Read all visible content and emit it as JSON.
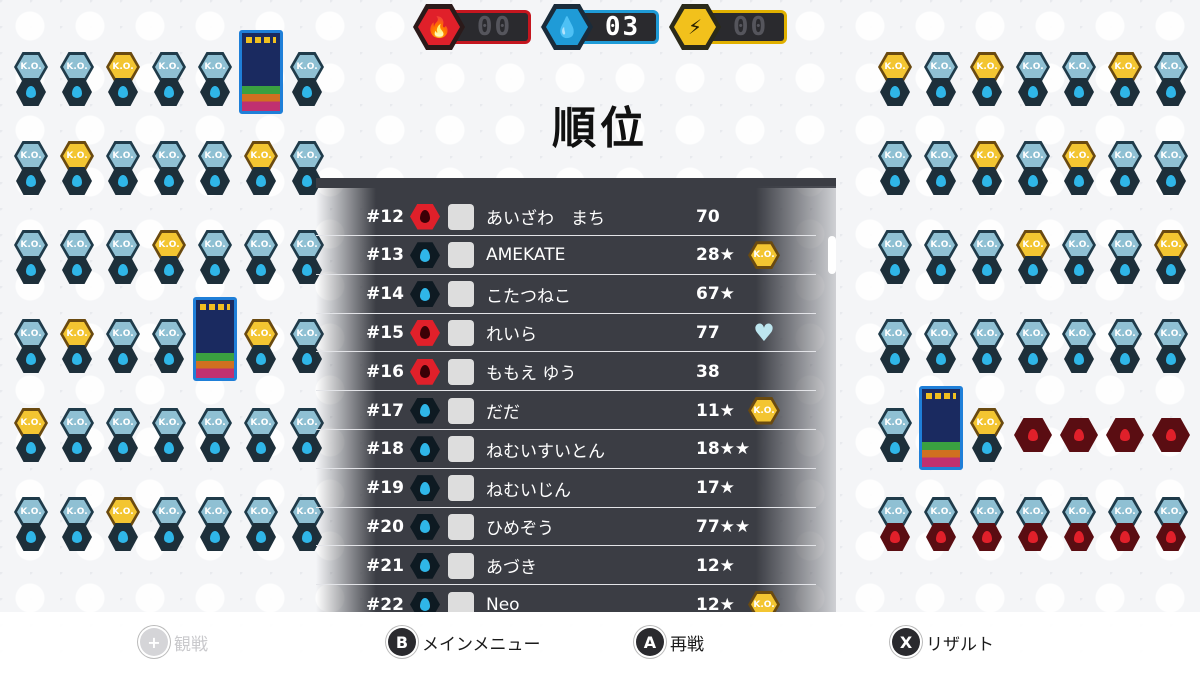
{
  "teams": [
    {
      "name": "fire",
      "icon": "flame-icon",
      "score": "00",
      "color": "#e0202a"
    },
    {
      "name": "water",
      "icon": "water-drop-icon",
      "score": "03",
      "color": "#1f9bd7"
    },
    {
      "name": "thunder",
      "icon": "lightning-icon",
      "score": "00",
      "color": "#f2c11c"
    }
  ],
  "title": "順位",
  "ko_label": "K.O.",
  "rankings": [
    {
      "rank": "#12",
      "team": "fire",
      "name": "あいざわ　まち",
      "score": "70",
      "mark": ""
    },
    {
      "rank": "#13",
      "team": "water",
      "name": "AMEKATE",
      "score": "28★",
      "mark": "ko"
    },
    {
      "rank": "#14",
      "team": "water",
      "name": "こたつねこ",
      "score": "67★",
      "mark": ""
    },
    {
      "rank": "#15",
      "team": "fire",
      "name": "れいら",
      "score": "77",
      "mark": "heart"
    },
    {
      "rank": "#16",
      "team": "fire",
      "name": "ももえ ゆう",
      "score": "38",
      "mark": ""
    },
    {
      "rank": "#17",
      "team": "water",
      "name": "だだ",
      "score": "11★",
      "mark": "ko"
    },
    {
      "rank": "#18",
      "team": "water",
      "name": "ねむいすいとん",
      "score": "18★★",
      "mark": ""
    },
    {
      "rank": "#19",
      "team": "water",
      "name": "ねむいじん",
      "score": "17★",
      "mark": ""
    },
    {
      "rank": "#20",
      "team": "water",
      "name": "ひめぞう",
      "score": "77★★",
      "mark": ""
    },
    {
      "rank": "#21",
      "team": "water",
      "name": "あづき",
      "score": "12★",
      "mark": ""
    },
    {
      "rank": "#22",
      "team": "water",
      "name": "Neo",
      "score": "12★",
      "mark": "ko"
    }
  ],
  "actions": {
    "spectate": {
      "button": "+",
      "label": "観戦"
    },
    "main_menu": {
      "button": "B",
      "label": "メインメニュー"
    },
    "rematch": {
      "button": "A",
      "label": "再戦"
    },
    "result": {
      "button": "X",
      "label": "リザルト"
    }
  },
  "left_grid": [
    "w",
    "w",
    "g",
    "w",
    "w",
    "board",
    "w",
    "w",
    "g",
    "w",
    "w",
    "w",
    "g",
    "w",
    "w",
    "w",
    "w",
    "g",
    "w",
    "w",
    "w",
    "w",
    "g",
    "w",
    "w",
    "board",
    "g",
    "w",
    "g",
    "w",
    "w",
    "w",
    "w",
    "w",
    "w",
    "w",
    "w",
    "g",
    "w",
    "w",
    "w",
    "w"
  ],
  "right_grid": [
    "g",
    "w",
    "g",
    "w",
    "w",
    "g",
    "w",
    "w",
    "w",
    "g",
    "w",
    "g",
    "w",
    "w",
    "w",
    "w",
    "w",
    "g",
    "w",
    "w",
    "g",
    "w",
    "w",
    "w",
    "w",
    "w",
    "w",
    "w",
    "w",
    "board",
    "g",
    "f",
    "f",
    "f",
    "f",
    "wf",
    "wf",
    "wf",
    "wf",
    "wf",
    "wf",
    "wf"
  ]
}
